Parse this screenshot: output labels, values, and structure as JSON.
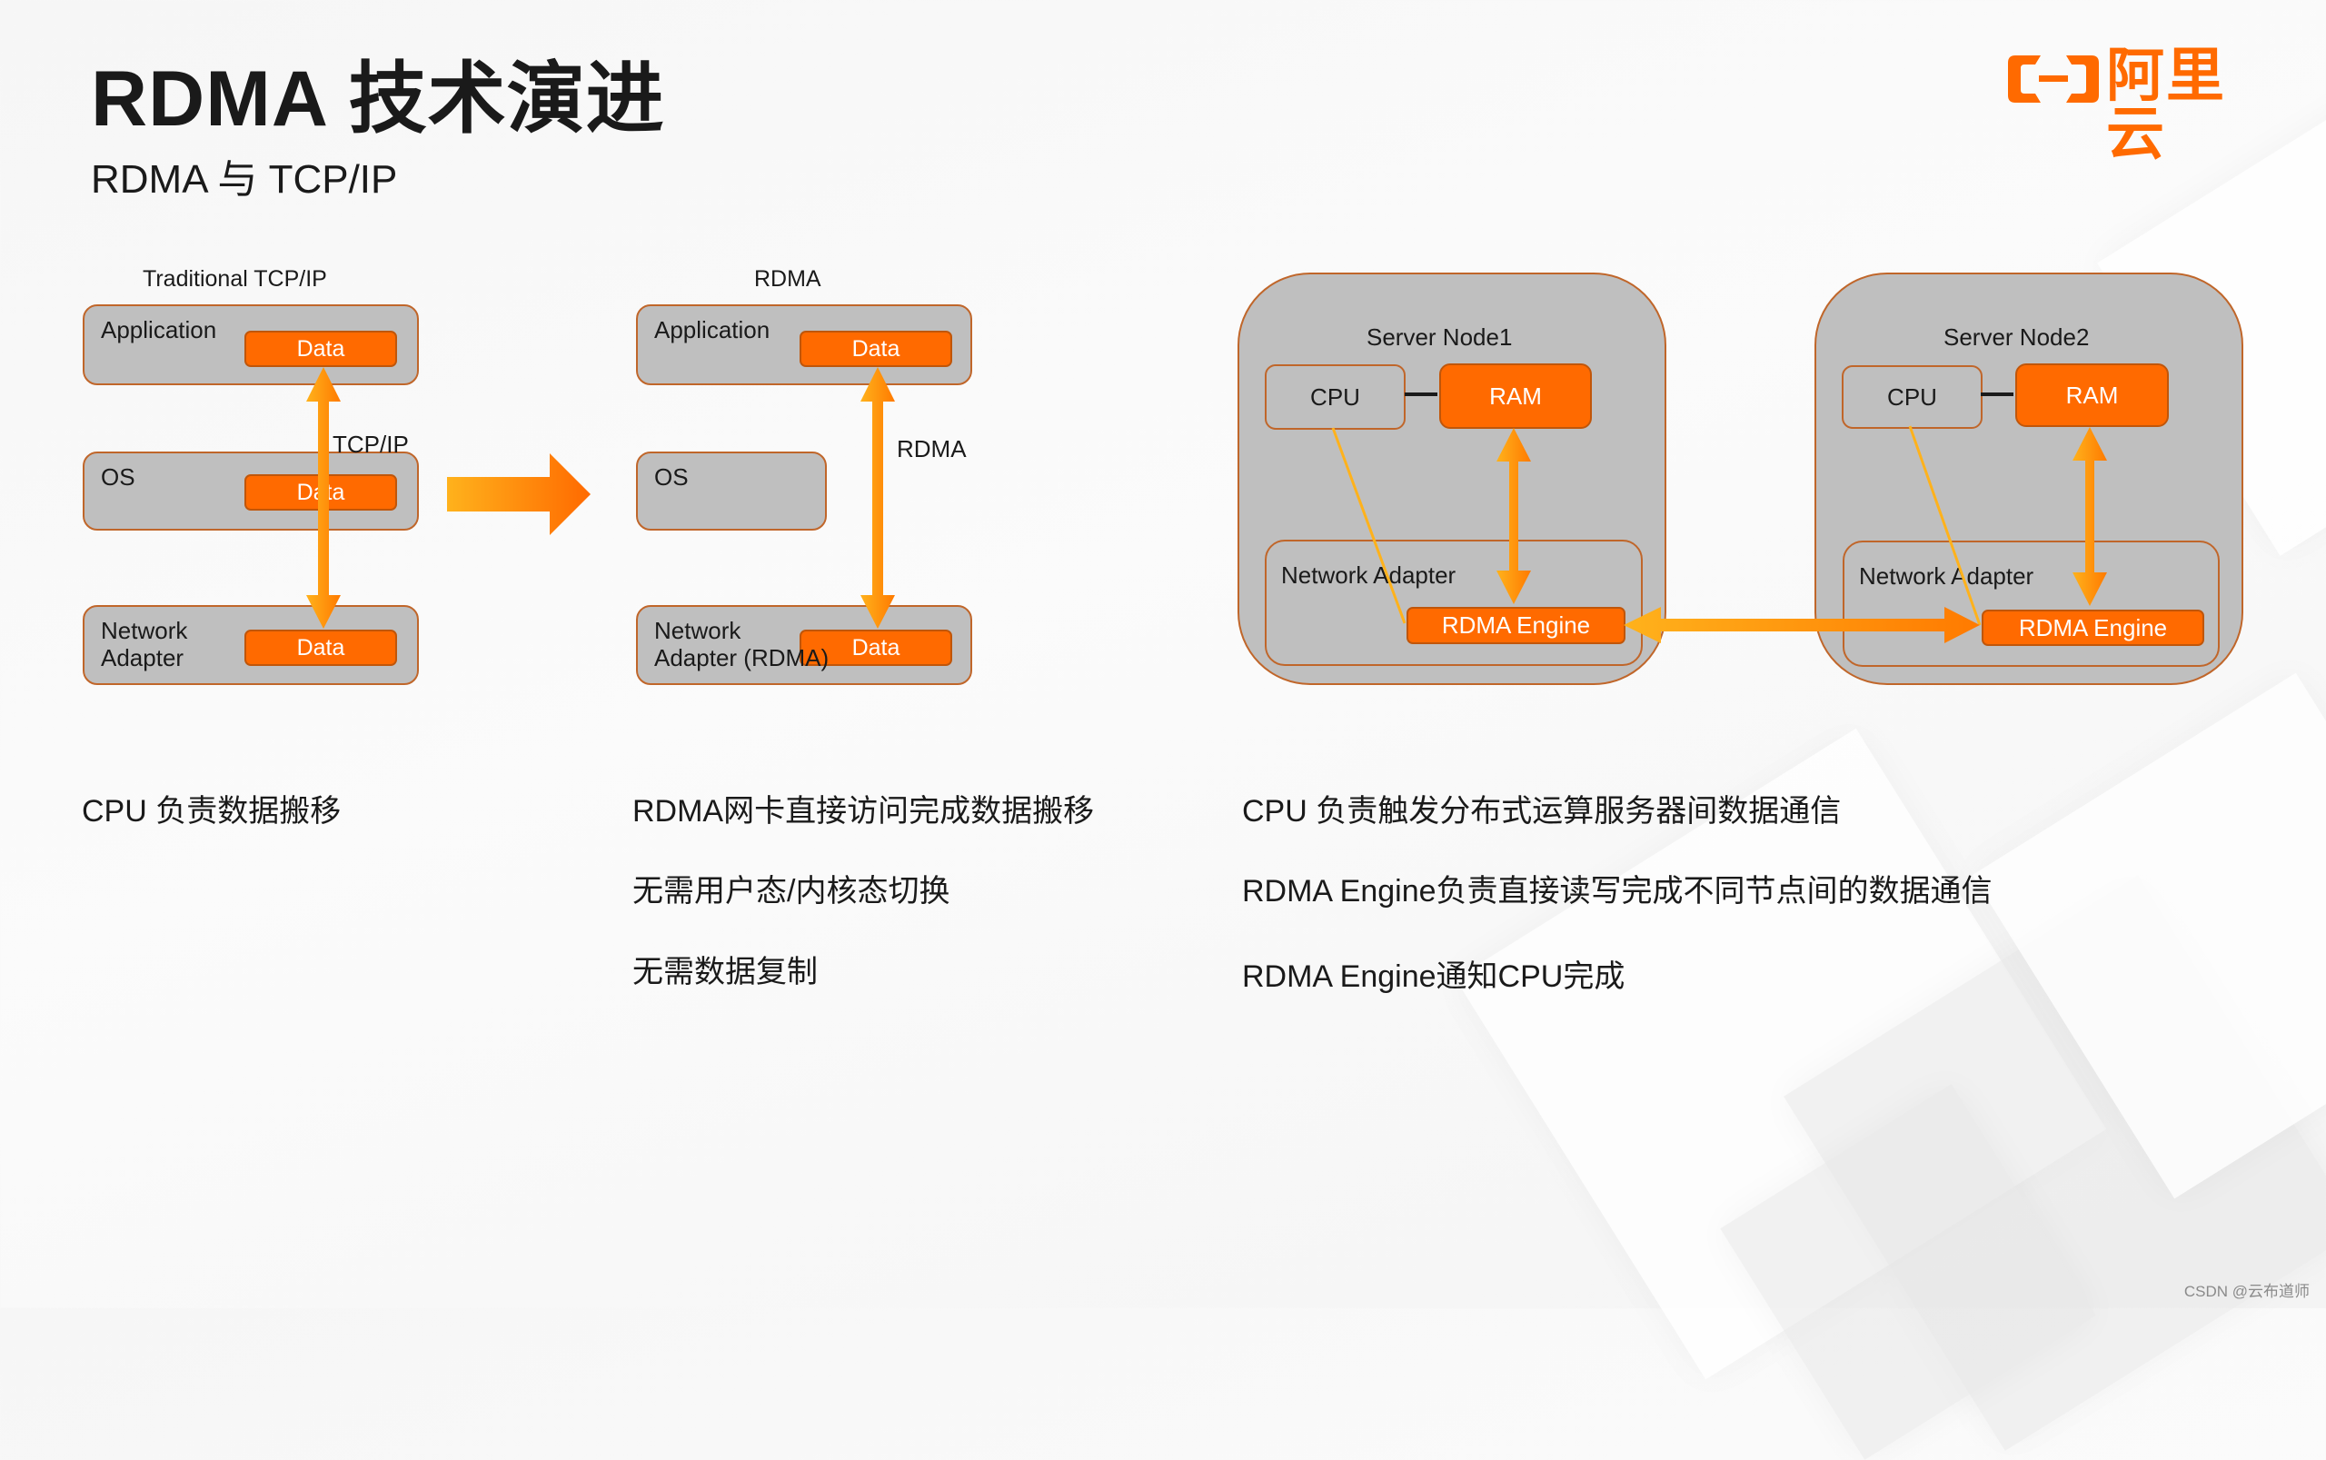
{
  "header": {
    "title": "RDMA 技术演进",
    "subtitle": "RDMA 与 TCP/IP",
    "logo_text": "阿里云",
    "logo_icon": "aliyun-bracket-icon",
    "brand_color": "#ff6a00"
  },
  "colors": {
    "accent_orange": "#ff6a00",
    "arrow_light": "#ffb21c",
    "arrow_dark": "#ff7a00",
    "box_gray": "#bfbfbf",
    "box_border": "#c0662a"
  },
  "tcp_diagram": {
    "label": "Traditional TCP/IP",
    "layers": [
      {
        "name": "Application",
        "data": "Data"
      },
      {
        "name": "OS",
        "data": "Data"
      },
      {
        "name": "Network\nAdapter",
        "data": "Data"
      }
    ],
    "arrow_label": "TCP/IP"
  },
  "transition_arrow": "right-arrow-icon",
  "rdma_diagram": {
    "label": "RDMA",
    "layers": [
      {
        "name": "Application",
        "data": "Data"
      },
      {
        "name": "OS"
      },
      {
        "name": "Network\nAdapter (RDMA)",
        "data": "Data"
      }
    ],
    "arrow_label": "RDMA"
  },
  "server_nodes": [
    {
      "title": "Server Node1",
      "cpu": "CPU",
      "ram": "RAM",
      "adapter": "Network Adapter",
      "engine": "RDMA Engine"
    },
    {
      "title": "Server Node2",
      "cpu": "CPU",
      "ram": "RAM",
      "adapter": "Network Adapter",
      "engine": "RDMA Engine"
    }
  ],
  "descriptions": {
    "tcp": [
      "CPU 负责数据搬移"
    ],
    "rdma": [
      "RDMA网卡直接访问完成数据搬移",
      "无需用户态/内核态切换",
      "无需数据复制"
    ],
    "nodes": [
      "CPU 负责触发分布式运算服务器间数据通信",
      "RDMA Engine负责直接读写完成不同节点间的数据通信",
      "RDMA Engine通知CPU完成"
    ]
  },
  "watermark": "CSDN @云布道师"
}
